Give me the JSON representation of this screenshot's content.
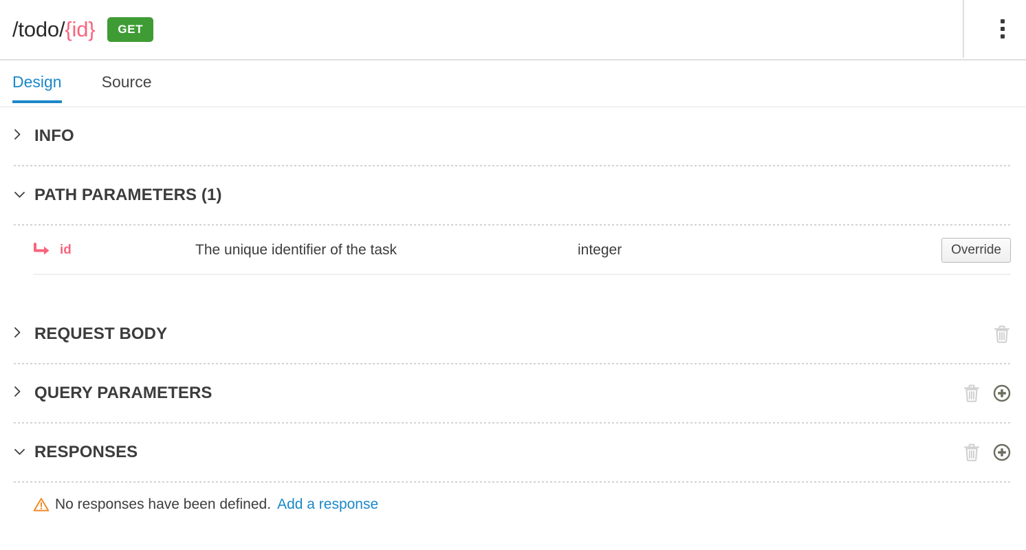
{
  "header": {
    "path_base": "/todo/",
    "path_var": "{id}",
    "method": "GET",
    "method_color": "#3f9c35",
    "path_var_color": "#f8657d",
    "menu_icon": "kebab-menu-icon"
  },
  "tabs": [
    {
      "label": "Design",
      "active": true
    },
    {
      "label": "Source",
      "active": false
    }
  ],
  "accent_color": "#1b87c9",
  "sections": [
    {
      "id": "info",
      "title": "INFO",
      "expanded": false,
      "chevron": "chevron-right-icon",
      "actions": []
    },
    {
      "id": "path-parameters",
      "title": "PATH PARAMETERS (1)",
      "expanded": true,
      "chevron": "chevron-down-icon",
      "actions": []
    },
    {
      "id": "request-body",
      "title": "REQUEST BODY",
      "expanded": false,
      "chevron": "chevron-right-icon",
      "actions": [
        "trash-icon"
      ]
    },
    {
      "id": "query-parameters",
      "title": "QUERY PARAMETERS",
      "expanded": false,
      "chevron": "chevron-right-icon",
      "actions": [
        "trash-icon",
        "plus-circle-icon"
      ]
    },
    {
      "id": "responses",
      "title": "RESPONSES",
      "expanded": true,
      "chevron": "chevron-down-icon",
      "actions": [
        "trash-icon",
        "plus-circle-icon"
      ]
    }
  ],
  "path_parameters": {
    "rows": [
      {
        "icon": "corner-down-right-arrow-icon",
        "name": "id",
        "description": "The unique identifier of the task",
        "type": "integer",
        "override_label": "Override"
      }
    ]
  },
  "responses": {
    "warning_icon": "warning-triangle-icon",
    "empty_message": "No responses have been defined.",
    "add_link": "Add a response"
  },
  "icon_colors": {
    "trash": "#d2d2d2",
    "plus_circle": "#6b6d5f",
    "warning": "#f08a24",
    "param_arrow": "#f8657d"
  }
}
